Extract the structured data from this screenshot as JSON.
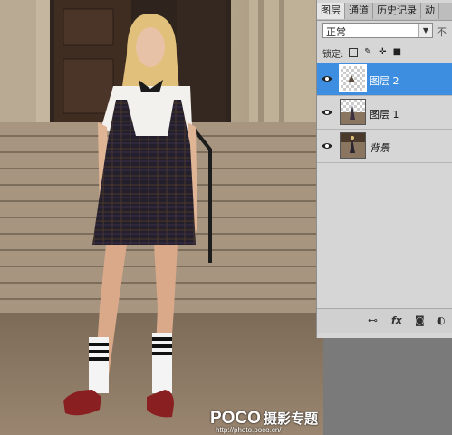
{
  "watermark": {
    "brand": "POCO",
    "title": "摄影专题",
    "url": "http://photo.poco.cn/"
  },
  "panel": {
    "tabs": [
      {
        "label": "图层",
        "active": true
      },
      {
        "label": "通道",
        "active": false
      },
      {
        "label": "历史记录",
        "active": false
      },
      {
        "label": "动",
        "active": false
      }
    ],
    "blend_mode": "正常",
    "opacity_label": "不",
    "lock_label": "锁定:",
    "layers": [
      {
        "name": "图层 2",
        "selected": true,
        "visible": true
      },
      {
        "name": "图层 1",
        "selected": false,
        "visible": true
      },
      {
        "name": "背景",
        "selected": false,
        "visible": true
      }
    ],
    "footer_buttons": {
      "link": "link-icon",
      "fx": "fx",
      "mask": "mask-icon",
      "adjust": "adjustment-icon"
    }
  },
  "colors": {
    "selection": "#3d8ee0",
    "panel_bg": "#d6d6d6"
  }
}
